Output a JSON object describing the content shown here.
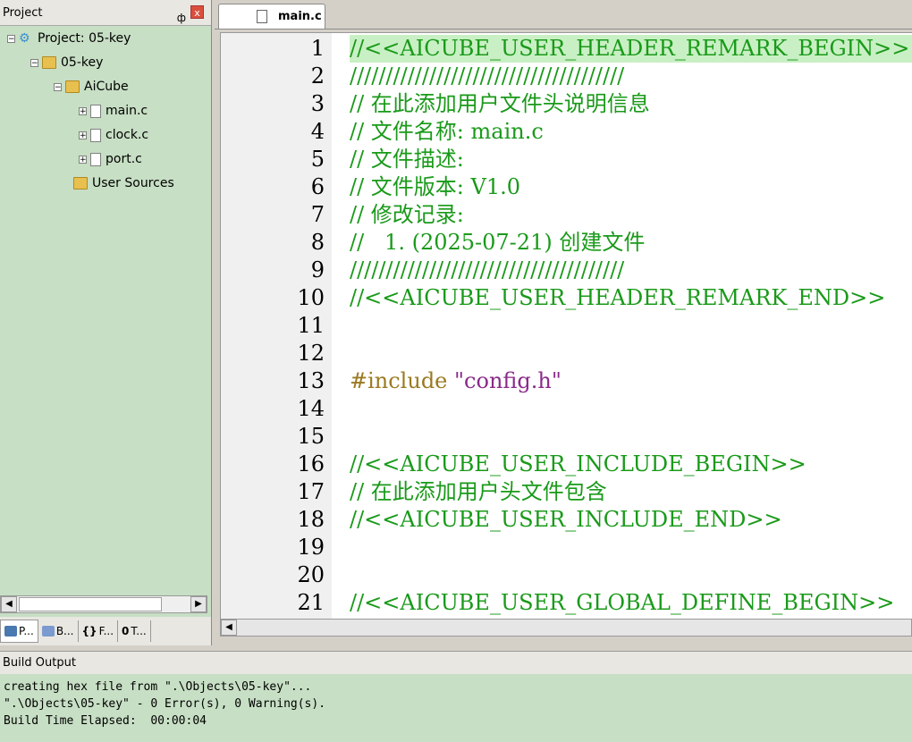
{
  "project_panel": {
    "title": "Project",
    "pin_glyph": "ф",
    "close_glyph": "x",
    "tree": [
      {
        "label": "Project: 05-key",
        "icon": "project-gear-icon",
        "expander": "−"
      },
      {
        "label": "05-key",
        "icon": "target-folder-icon",
        "expander": "−"
      },
      {
        "label": "AiCube",
        "icon": "folder-open-icon",
        "expander": "−"
      },
      {
        "label": "main.c",
        "icon": "file-icon",
        "expander": "+"
      },
      {
        "label": "clock.c",
        "icon": "file-icon",
        "expander": "+"
      },
      {
        "label": "port.c",
        "icon": "file-icon",
        "expander": "+"
      },
      {
        "label": "User Sources",
        "icon": "folder-icon",
        "expander": ""
      }
    ],
    "tabs": [
      {
        "label": "P...",
        "icon": "project-tab-icon"
      },
      {
        "label": "B...",
        "icon": "books-tab-icon"
      },
      {
        "label": "F...",
        "icon": "functions-tab-icon",
        "glyph": "{}"
      },
      {
        "label": "T...",
        "icon": "templates-tab-icon",
        "glyph": "0"
      }
    ]
  },
  "editor": {
    "tab_label": "main.c",
    "lines": [
      {
        "n": "1",
        "code": "//<<AICUBE_USER_HEADER_REMARK_BEGIN>>",
        "cls": "c-comment",
        "hl": true
      },
      {
        "n": "2",
        "code": "//////////////////////////////////////",
        "cls": "c-comment"
      },
      {
        "n": "3",
        "code": "// 在此添加用户文件头说明信息",
        "cls": "c-comment"
      },
      {
        "n": "4",
        "code": "// 文件名称: main.c",
        "cls": "c-comment"
      },
      {
        "n": "5",
        "code": "// 文件描述:",
        "cls": "c-comment"
      },
      {
        "n": "6",
        "code": "// 文件版本: V1.0",
        "cls": "c-comment"
      },
      {
        "n": "7",
        "code": "// 修改记录:",
        "cls": "c-comment"
      },
      {
        "n": "8",
        "code": "//   1. (2025-07-21) 创建文件",
        "cls": "c-comment"
      },
      {
        "n": "9",
        "code": "//////////////////////////////////////",
        "cls": "c-comment"
      },
      {
        "n": "10",
        "code": "//<<AICUBE_USER_HEADER_REMARK_END>>",
        "cls": "c-comment"
      },
      {
        "n": "11",
        "code": "",
        "cls": ""
      },
      {
        "n": "12",
        "code": "",
        "cls": ""
      },
      {
        "n": "13",
        "code": "#include",
        "cls": "c-pre",
        "str": " \"config.h\""
      },
      {
        "n": "14",
        "code": "",
        "cls": ""
      },
      {
        "n": "15",
        "code": "",
        "cls": ""
      },
      {
        "n": "16",
        "code": "//<<AICUBE_USER_INCLUDE_BEGIN>>",
        "cls": "c-comment"
      },
      {
        "n": "17",
        "code": "// 在此添加用户头文件包含",
        "cls": "c-comment"
      },
      {
        "n": "18",
        "code": "//<<AICUBE_USER_INCLUDE_END>>",
        "cls": "c-comment"
      },
      {
        "n": "19",
        "code": "",
        "cls": ""
      },
      {
        "n": "20",
        "code": "",
        "cls": ""
      },
      {
        "n": "21",
        "code": "//<<AICUBE_USER_GLOBAL_DEFINE_BEGIN>>",
        "cls": "c-comment"
      }
    ]
  },
  "build_output": {
    "title": "Build Output",
    "lines": [
      "creating hex file from \".\\Objects\\05-key\"...",
      "\".\\Objects\\05-key\" - 0 Error(s), 0 Warning(s).",
      "Build Time Elapsed:  00:00:04"
    ]
  }
}
